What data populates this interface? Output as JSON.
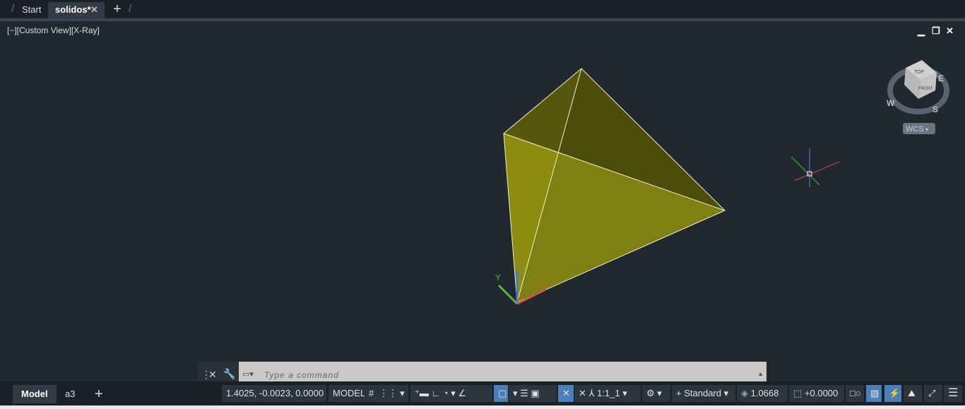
{
  "tabs": [
    {
      "label": "Start"
    },
    {
      "label": "solidos*"
    }
  ],
  "view_label": "[−][Custom View][X-Ray]",
  "viewcube": {
    "top": "TOP",
    "front": "FRONT",
    "compass": [
      "W",
      "S",
      "E"
    ],
    "wcs": "WCS"
  },
  "ucs": {
    "x": "X",
    "y": "Y",
    "z": "Z"
  },
  "command": {
    "placeholder": "Type a command"
  },
  "layout_tabs": [
    {
      "label": "Model"
    },
    {
      "label": "a3"
    }
  ],
  "status": {
    "coords": "1.4025, -0.0023, 0.0000",
    "space": "MODEL",
    "scale": "1:1_1",
    "style": "Standard",
    "lineweight": "1.0668",
    "elevation": "+0.0000"
  },
  "colors": {
    "face_dark": "#4d4c0b",
    "face_mid": "#7f7f12",
    "face_light": "#8c8c10",
    "accent": "#4b7fb8"
  }
}
